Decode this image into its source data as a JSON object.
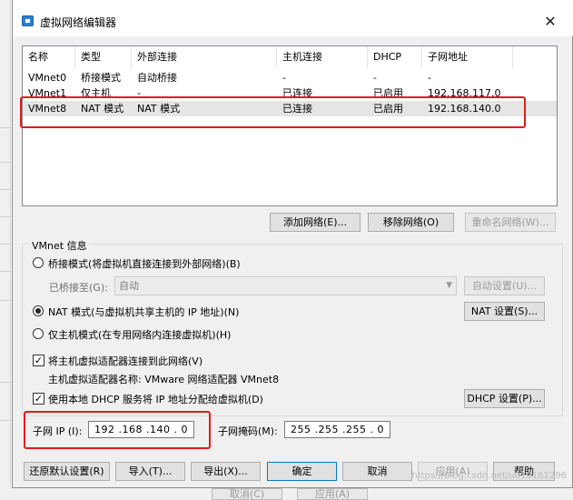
{
  "background_window": {
    "buttons": [
      "取消(C)",
      "应用(A)"
    ]
  },
  "dialog": {
    "title": "虚拟网络编辑器",
    "columns": [
      "名称",
      "类型",
      "外部连接",
      "主机连接",
      "DHCP",
      "子网地址"
    ],
    "rows": [
      {
        "name": "VMnet0",
        "type": "桥接模式",
        "external": "自动桥接",
        "host": "-",
        "dhcp": "-",
        "subnet": "-"
      },
      {
        "name": "VMnet1",
        "type": "仅主机",
        "external": "-",
        "host": "已连接",
        "dhcp": "已启用",
        "subnet": "192.168.117.0"
      },
      {
        "name": "VMnet8",
        "type": "NAT 模式",
        "external": "NAT 模式",
        "host": "已连接",
        "dhcp": "已启用",
        "subnet": "192.168.140.0"
      }
    ],
    "list_buttons": {
      "add": "添加网络(E)...",
      "remove": "移除网络(O)",
      "rename": "重命名网络(W)..."
    },
    "vmnet_info": {
      "title": "VMnet 信息",
      "bridged_label": "桥接模式(将虚拟机直接连接到外部网络)(B)",
      "bridged_to_label": "已桥接至(G):",
      "bridged_to_value": "自动",
      "auto_settings": "自动设置(U)...",
      "nat_label": "NAT 模式(与虚拟机共享主机的 IP 地址)(N)",
      "nat_settings": "NAT 设置(S)...",
      "hostonly_label": "仅主机模式(在专用网络内连接虚拟机)(H)",
      "connect_adapter_label": "将主机虚拟适配器连接到此网络(V)",
      "adapter_name_label": "主机虚拟适配器名称: VMware 网络适配器 VMnet8",
      "dhcp_label": "使用本地 DHCP 服务将 IP 地址分配给虚拟机(D)",
      "dhcp_settings": "DHCP 设置(P)...",
      "subnet_ip_label": "子网 IP (I):",
      "subnet_ip_value": "192 .168 .140 .  0",
      "subnet_mask_label": "子网掩码(M):",
      "subnet_mask_value": "255 .255 .255 .  0"
    },
    "footer_buttons": {
      "restore": "还原默认设置(R)",
      "import": "导入(T)...",
      "export": "导出(X)...",
      "ok": "确定",
      "cancel": "取消",
      "apply": "应用(A)",
      "help": "帮助"
    },
    "watermark": "https://blog.csdn.net/u010161296"
  },
  "colors": {
    "highlight_box": "#e41b1b",
    "selected_row": "#e5e5e5",
    "dialog_bg": "#f0f0f0"
  }
}
